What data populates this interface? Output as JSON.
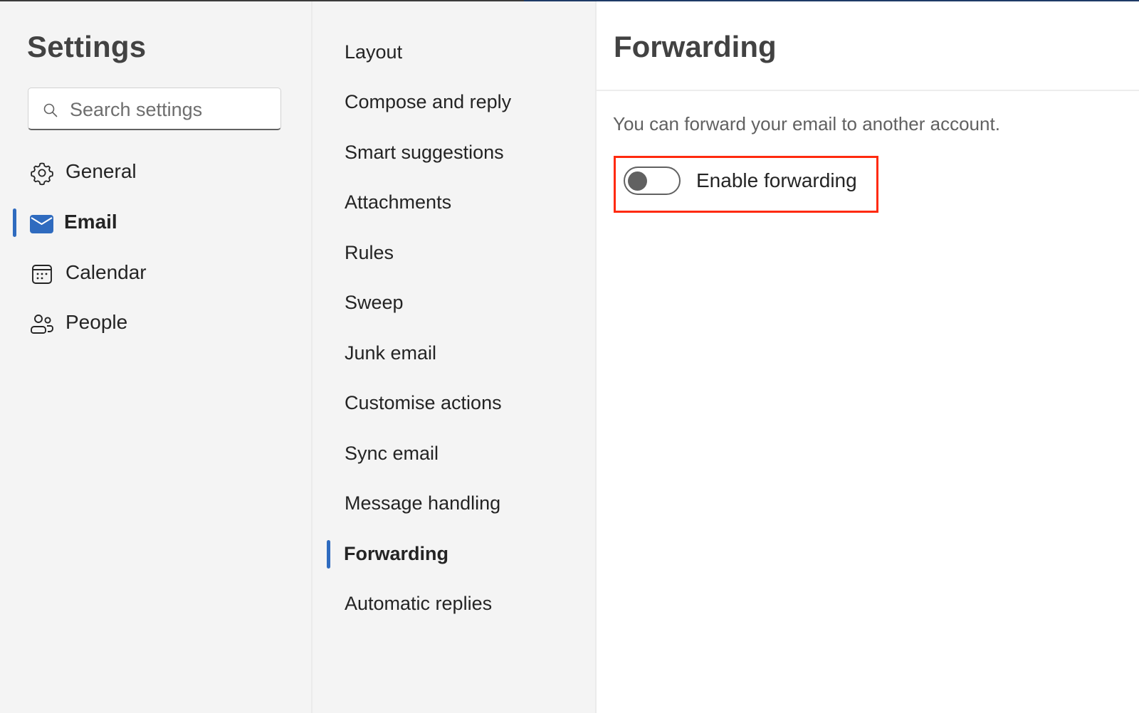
{
  "settings_panel": {
    "title": "Settings",
    "search": {
      "placeholder": "Search settings",
      "value": ""
    },
    "nav_items": [
      {
        "label": "General",
        "icon": "gear-icon",
        "active": false
      },
      {
        "label": "Email",
        "icon": "mail-icon",
        "active": true
      },
      {
        "label": "Calendar",
        "icon": "calendar-icon",
        "active": false
      },
      {
        "label": "People",
        "icon": "people-icon",
        "active": false
      }
    ]
  },
  "email_submenu": {
    "items": [
      {
        "label": "Layout",
        "active": false
      },
      {
        "label": "Compose and reply",
        "active": false
      },
      {
        "label": "Smart suggestions",
        "active": false
      },
      {
        "label": "Attachments",
        "active": false
      },
      {
        "label": "Rules",
        "active": false
      },
      {
        "label": "Sweep",
        "active": false
      },
      {
        "label": "Junk email",
        "active": false
      },
      {
        "label": "Customise actions",
        "active": false
      },
      {
        "label": "Sync email",
        "active": false
      },
      {
        "label": "Message handling",
        "active": false
      },
      {
        "label": "Forwarding",
        "active": true
      },
      {
        "label": "Automatic replies",
        "active": false
      }
    ]
  },
  "content": {
    "title": "Forwarding",
    "description": "You can forward your email to another account.",
    "toggle": {
      "label": "Enable forwarding",
      "checked": false
    }
  },
  "colors": {
    "accent": "#2f6bbf",
    "highlight_box": "#ff2a0e",
    "sidebar_bg": "#f4f4f4"
  }
}
